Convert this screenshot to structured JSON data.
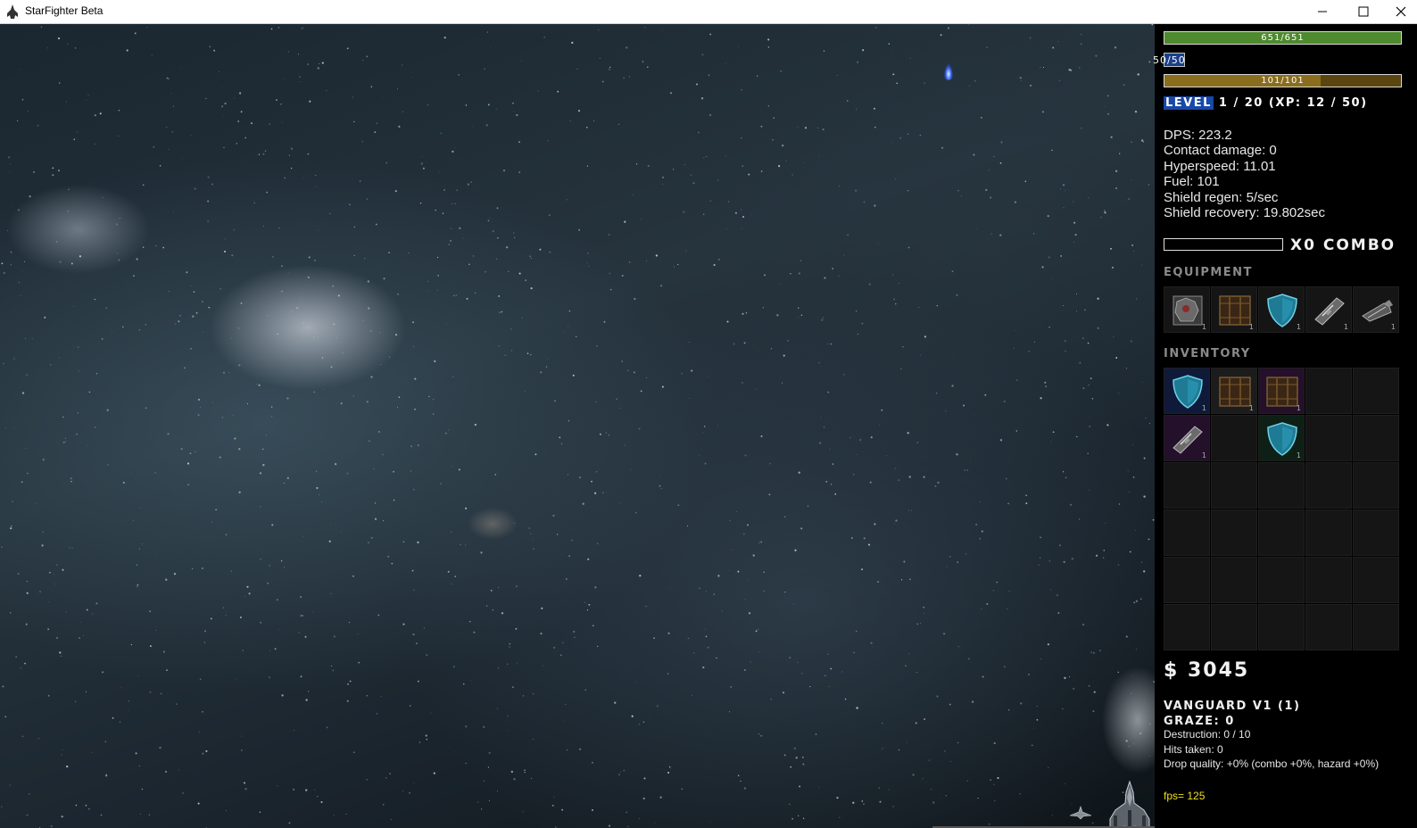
{
  "window": {
    "title": "StarFighter Beta",
    "app_icon": "spaceship-icon",
    "controls": [
      "minimize-icon",
      "maximize-icon",
      "close-icon"
    ]
  },
  "hud": {
    "hull": {
      "text": "651/651",
      "current": 651,
      "max": 651,
      "color": "#4e8a2e"
    },
    "shield": {
      "text": "50/50",
      "current": 50,
      "max": 50,
      "color": "#1b3f8a"
    },
    "fuel": {
      "text": "101/101",
      "current": 101,
      "max": 101,
      "color": "#8a6e1e"
    },
    "level_label": "LEVEL",
    "level_rest": " 1 / 20 (XP: 12 / 50)",
    "stats": [
      "DPS: 223.2",
      "Contact damage: 0",
      "Hyperspeed: 11.01",
      "Fuel: 101",
      "Shield regen: 5/sec",
      "Shield recovery: 19.802sec"
    ],
    "combo": {
      "text": "X0 COMBO",
      "fill": 0
    },
    "equipment_label": "EQUIPMENT",
    "inventory_label": "INVENTORY",
    "equipment": [
      {
        "icon": "armor-module-icon",
        "qty": "1"
      },
      {
        "icon": "cargo-crate-icon",
        "qty": "1"
      },
      {
        "icon": "shield-icon",
        "qty": "1"
      },
      {
        "icon": "laser-cannon-icon",
        "qty": "1"
      },
      {
        "icon": "engine-icon",
        "qty": "1"
      }
    ],
    "inventory": [
      {
        "icon": "shield-icon",
        "qty": "1",
        "rarity": "blue"
      },
      {
        "icon": "cargo-crate-icon",
        "qty": "1",
        "rarity": "plain"
      },
      {
        "icon": "cargo-crate-icon",
        "qty": "1",
        "rarity": "purple"
      },
      null,
      null,
      {
        "icon": "laser-cannon-icon",
        "qty": "1",
        "rarity": "purple"
      },
      null,
      {
        "icon": "shield-icon",
        "qty": "1",
        "rarity": "green"
      },
      null,
      null,
      null,
      null,
      null,
      null,
      null,
      null,
      null,
      null,
      null,
      null,
      null,
      null,
      null,
      null,
      null,
      null,
      null,
      null,
      null,
      null
    ],
    "money": "$ 3045",
    "ship_name": "VANGUARD V1 (1)",
    "graze": "GRAZE: 0",
    "info": [
      "Destruction: 0 / 10",
      "Hits taken: 0",
      "Drop quality: +0% (combo +0%, hazard +0%)"
    ],
    "fps": "fps= 125"
  },
  "scene": {
    "entities": [
      "player-ship-icon",
      "wingman-drone-icon",
      "blue-flame-projectile-icon"
    ]
  }
}
